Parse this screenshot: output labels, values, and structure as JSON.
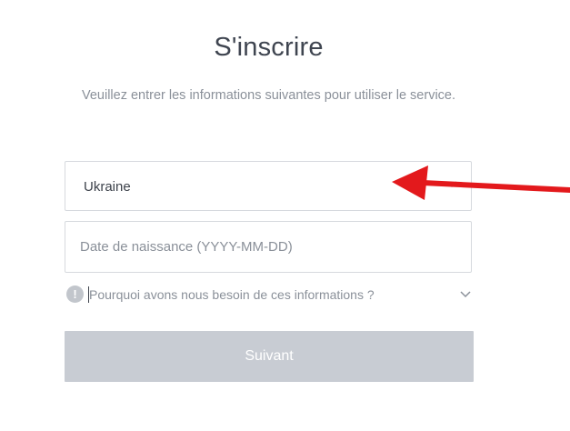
{
  "header": {
    "title": "S'inscrire",
    "subtitle": "Veuillez entrer les informations suivantes pour utiliser le service."
  },
  "form": {
    "country_select": {
      "value": "Ukraine",
      "icon": "chevron-down-icon"
    },
    "birthdate_input": {
      "value": "",
      "placeholder": "Date de naissance (YYYY-MM-DD)"
    },
    "info": {
      "icon": "info-icon",
      "icon_glyph": "!",
      "text": "Pourquoi avons nous besoin de ces informations ?",
      "toggle_icon": "chevron-down-icon"
    },
    "submit_label": "Suivant"
  },
  "annotation": {
    "icon": "red-arrow-icon",
    "color": "#e3191c"
  },
  "colors": {
    "button_disabled": "#c8ccd3",
    "border": "#d6d9de",
    "muted_text": "#8a9099",
    "title_text": "#3f4550"
  }
}
